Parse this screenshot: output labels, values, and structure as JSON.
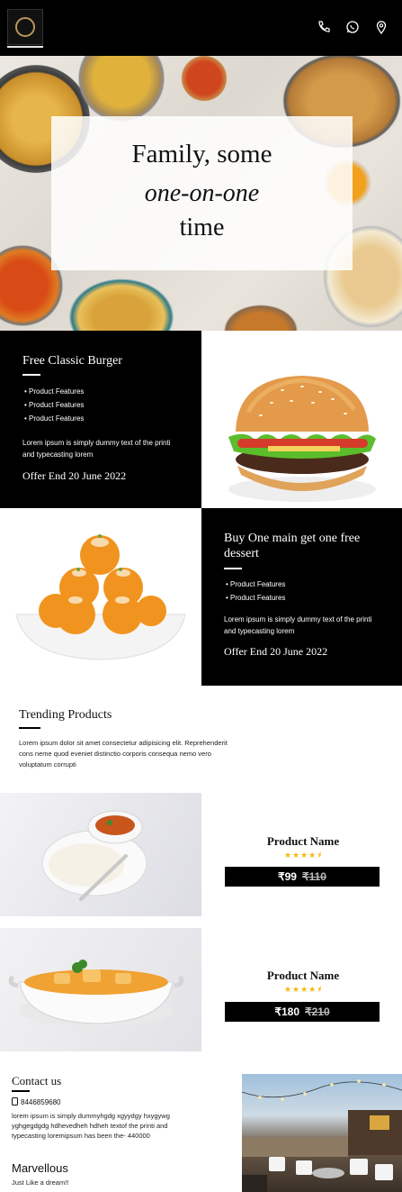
{
  "header": {
    "logo_icon": "restaurant-crest-logo",
    "icons": [
      "phone-icon",
      "whatsapp-icon",
      "location-pin-icon"
    ]
  },
  "hero": {
    "line1": "Family, some",
    "line2": "one-on-one",
    "line3": "time"
  },
  "promo1": {
    "title": "Free Classic Burger",
    "features": [
      "Product Features",
      "Product Features",
      "Product Features"
    ],
    "description": "Lorem ipsum is simply dummy text of the printi and typecasting lorem",
    "offer": "Offer End 20 June 2022"
  },
  "promo2": {
    "title": "Buy One main get one free dessert",
    "features": [
      "Product Features",
      "Product Features"
    ],
    "description": "Lorem ipsum is simply dummy text of the printi and typecasting lorem",
    "offer": "Offer End 20 June 2022"
  },
  "trending": {
    "title": "Trending Products",
    "description": "Lorem ipsum dolor sit amet consectetur adipisicing elit. Reprehenderit cons neme quod eveniet distinctio corporis consequa nemo vero voluptatum corrupti"
  },
  "products": [
    {
      "name": "Product Name",
      "rating": 4.5,
      "stars": "★★★★⯨",
      "price": "₹99",
      "old_price": "₹110"
    },
    {
      "name": "Product Name",
      "rating": 4.5,
      "stars": "★★★★⯨",
      "price": "₹180",
      "old_price": "₹210"
    }
  ],
  "contact": {
    "title": "Contact us",
    "phone": "8446859680",
    "description": "lorem ipsum is simply dummyhgdg xgyydgy hxygywg yghgegdgdg hdhevedheh hdheh textof the printi and typecasting loremipsum has been the- 440000",
    "brand": "Marvellous",
    "tagline": "Just Like a dream!!"
  },
  "colors": {
    "black": "#000000",
    "star": "#f2b90c",
    "logo_gold": "#b8975a"
  }
}
